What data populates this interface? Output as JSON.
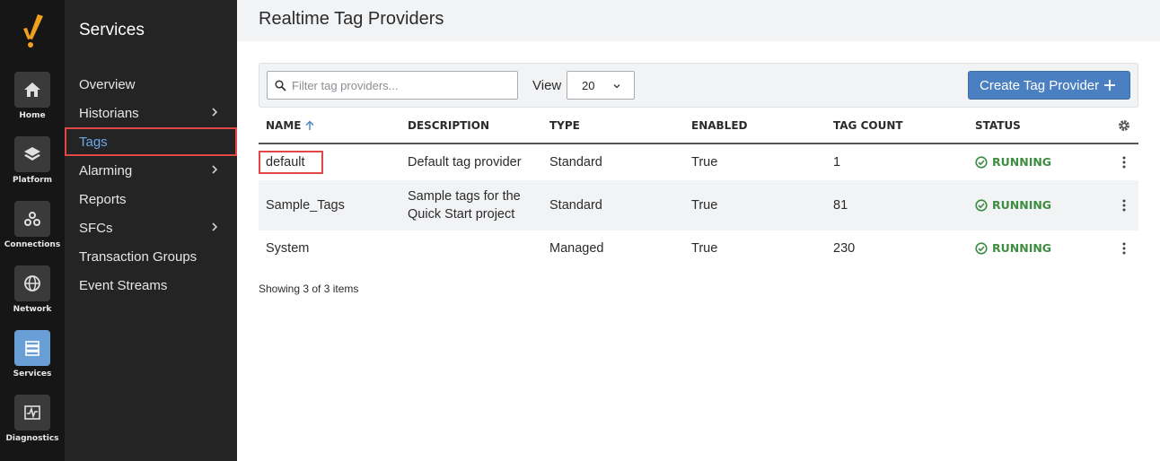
{
  "rail": {
    "items": [
      {
        "label": "Home",
        "icon": "home-icon"
      },
      {
        "label": "Platform",
        "icon": "layers-icon"
      },
      {
        "label": "Connections",
        "icon": "connections-icon"
      },
      {
        "label": "Network",
        "icon": "globe-icon"
      },
      {
        "label": "Services",
        "icon": "services-icon",
        "active": true
      },
      {
        "label": "Diagnostics",
        "icon": "diagnostics-icon"
      }
    ]
  },
  "sidebar": {
    "title": "Services",
    "items": [
      {
        "label": "Overview"
      },
      {
        "label": "Historians",
        "has_submenu": true
      },
      {
        "label": "Tags",
        "active": true
      },
      {
        "label": "Alarming",
        "has_submenu": true
      },
      {
        "label": "Reports"
      },
      {
        "label": "SFCs",
        "has_submenu": true
      },
      {
        "label": "Transaction Groups"
      },
      {
        "label": "Event Streams"
      }
    ]
  },
  "page": {
    "title": "Realtime Tag Providers"
  },
  "toolbar": {
    "search_placeholder": "Filter tag providers...",
    "view_label": "View",
    "view_value": "20",
    "create_label": "Create Tag Provider"
  },
  "table": {
    "headers": {
      "name": "NAME",
      "description": "DESCRIPTION",
      "type": "TYPE",
      "enabled": "ENABLED",
      "tag_count": "TAG COUNT",
      "status": "STATUS"
    },
    "rows": [
      {
        "name": "default",
        "description": "Default tag provider",
        "type": "Standard",
        "enabled": "True",
        "tag_count": "1",
        "status": "RUNNING"
      },
      {
        "name": "Sample_Tags",
        "description_line1": "Sample tags for the",
        "description_line2": "Quick Start project",
        "type": "Standard",
        "enabled": "True",
        "tag_count": "81",
        "status": "RUNNING"
      },
      {
        "name": "System",
        "description": "",
        "type": "Managed",
        "enabled": "True",
        "tag_count": "230",
        "status": "RUNNING"
      }
    ],
    "footer": "Showing 3 of 3 items"
  },
  "colors": {
    "accent": "#4a7fc1",
    "running": "#3d8c40",
    "highlight": "#e04848"
  }
}
